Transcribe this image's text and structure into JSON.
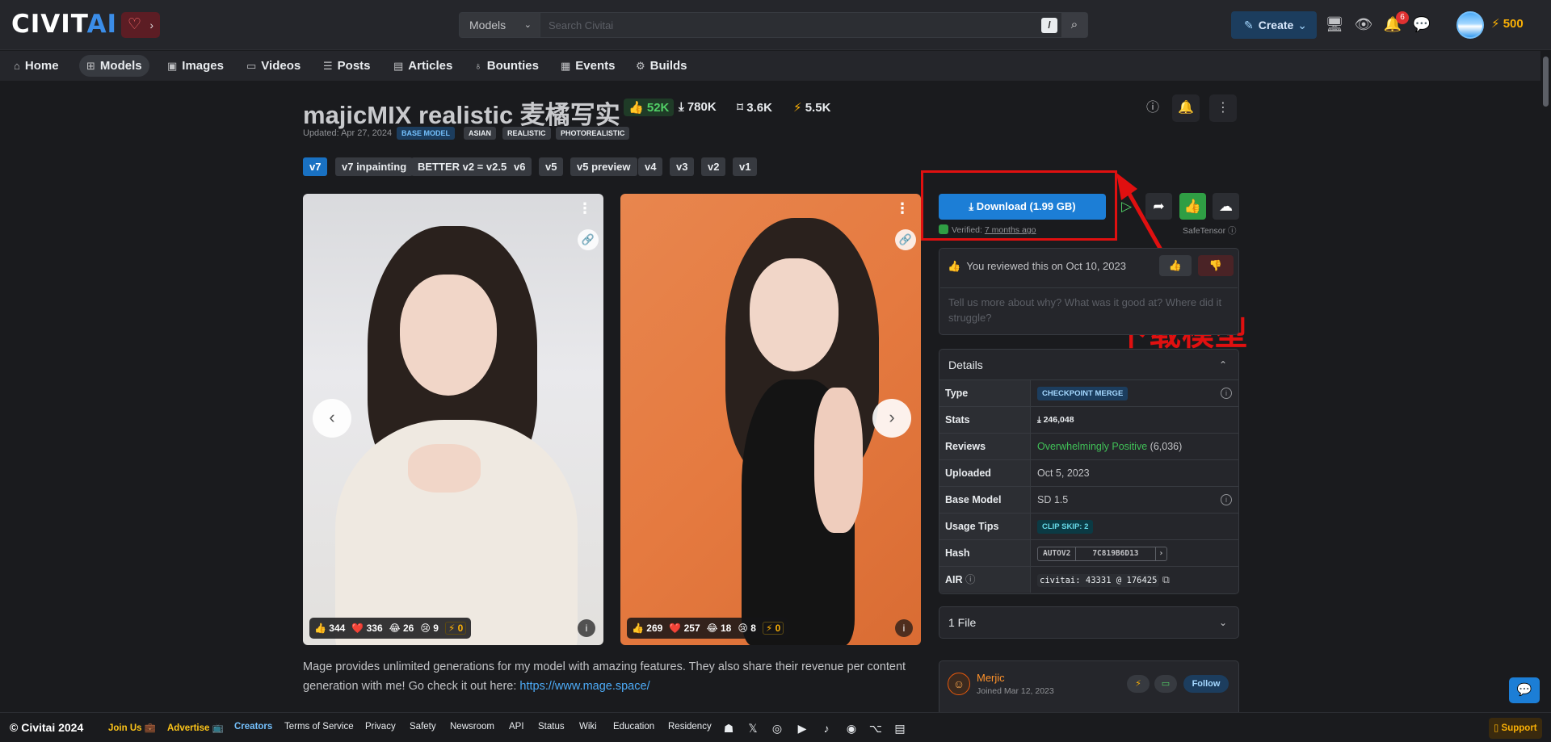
{
  "header": {
    "logo_main": "CIVIT",
    "logo_ai": "AI",
    "search_category": "Models",
    "search_placeholder": "Search Civitai",
    "search_shortcut": "/",
    "create_label": "Create",
    "notification_count": "6",
    "buzz_amount": "500"
  },
  "nav": {
    "items": [
      {
        "label": "Home",
        "icon": "home-icon"
      },
      {
        "label": "Models",
        "icon": "grid-icon",
        "active": true
      },
      {
        "label": "Images",
        "icon": "photo-icon"
      },
      {
        "label": "Videos",
        "icon": "video-icon"
      },
      {
        "label": "Posts",
        "icon": "layout-list-icon"
      },
      {
        "label": "Articles",
        "icon": "file-text-icon"
      },
      {
        "label": "Bounties",
        "icon": "moneybag-icon"
      },
      {
        "label": "Events",
        "icon": "calendar-icon"
      },
      {
        "label": "Builds",
        "icon": "cpu-icon"
      }
    ]
  },
  "model": {
    "title": "majicMIX realistic 麦橘写实",
    "stats": {
      "likes": "52K",
      "downloads": "780K",
      "bookmarks": "3.6K",
      "buzz": "5.5K"
    },
    "updated": "Updated: Apr 27, 2024",
    "tags": [
      "BASE MODEL",
      "ASIAN",
      "REALISTIC",
      "PHOTOREALISTIC"
    ],
    "versions": [
      "v7",
      "v7 inpainting",
      "BETTER v2 = v2.5",
      "v6",
      "v5",
      "v5 preview",
      "v4",
      "v3",
      "v2",
      "v1"
    ],
    "description": "Mage provides unlimited generations for my model with amazing features. They also share their revenue per content generation with me! Go check it out here: ",
    "description_link": "https://www.mage.space/"
  },
  "images": [
    {
      "likes": "344",
      "hearts": "336",
      "laugh": "26",
      "cry": "9",
      "buzz": "0"
    },
    {
      "likes": "269",
      "hearts": "257",
      "laugh": "18",
      "cry": "8",
      "buzz": "0"
    }
  ],
  "download": {
    "label": "Download (1.99 GB)",
    "verified_prefix": "Verified: ",
    "verified_time": "7 months ago",
    "format": "SafeTensor"
  },
  "annotation": {
    "label": "下载模型",
    "color": "#e01010"
  },
  "review": {
    "text": "You reviewed this on Oct 10, 2023",
    "placeholder": "Tell us more about why? What was it good at? Where did it struggle?"
  },
  "details": {
    "title": "Details",
    "rows": {
      "type_label": "Type",
      "type_value": "CHECKPOINT MERGE",
      "stats_label": "Stats",
      "stats_value": "246,048",
      "reviews_label": "Reviews",
      "reviews_value": "Overwhelmingly Positive",
      "reviews_count": "(6,036)",
      "uploaded_label": "Uploaded",
      "uploaded_value": "Oct 5, 2023",
      "base_label": "Base Model",
      "base_value": "SD 1.5",
      "tips_label": "Usage Tips",
      "tips_value": "CLIP SKIP: 2",
      "hash_label": "Hash",
      "hash_type": "AUTOV2",
      "hash_value": "7C819B6D13",
      "air_label": "AIR",
      "air_prefix": "civitai:",
      "air_model": "43331",
      "air_at": "@",
      "air_version": "176425"
    }
  },
  "files": {
    "label": "1 File"
  },
  "creator": {
    "name": "Merjic",
    "joined": "Joined Mar 12, 2023",
    "follow": "Follow"
  },
  "footer": {
    "copyright": "© Civitai 2024",
    "links": [
      "Join Us 💼",
      "Advertise 📺",
      "Creators",
      "Terms of Service",
      "Privacy",
      "Safety",
      "Newsroom",
      "API",
      "Status",
      "Wiki",
      "Education",
      "Residency"
    ],
    "support": "Support"
  }
}
